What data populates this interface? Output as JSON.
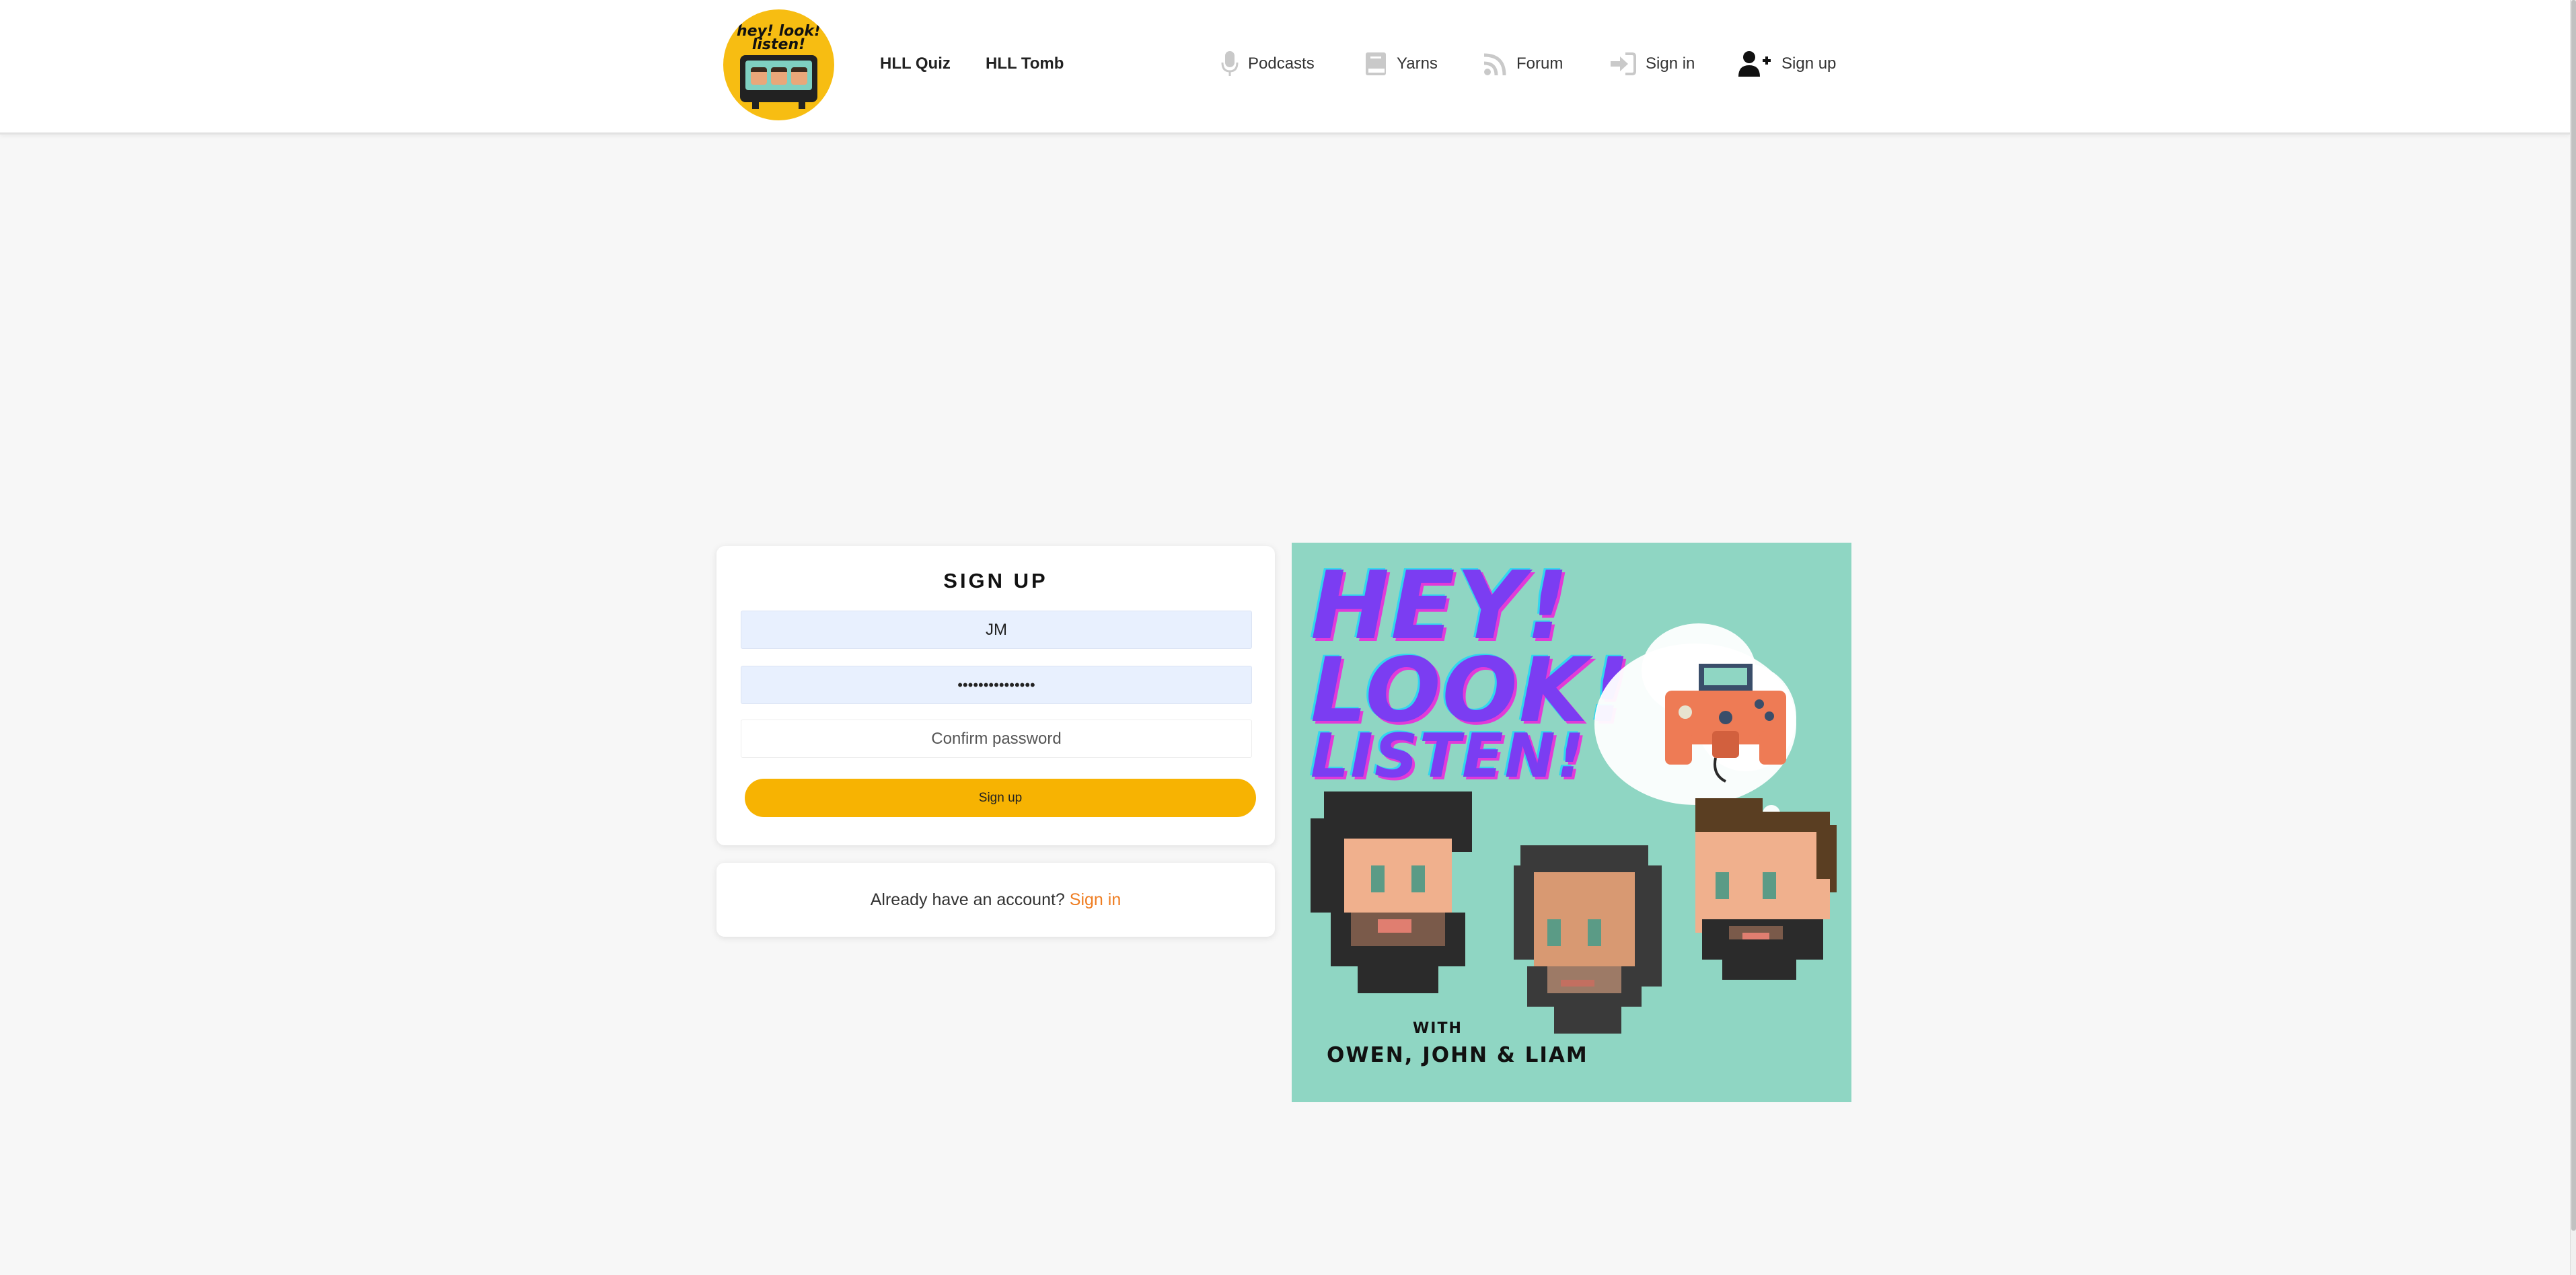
{
  "header": {
    "logo_text_line1": "hey! look!",
    "logo_text_line2": "listen!",
    "left_links": [
      {
        "label": "HLL Quiz"
      },
      {
        "label": "HLL Tomb"
      }
    ],
    "right_links": [
      {
        "label": "Podcasts",
        "icon": "microphone-icon"
      },
      {
        "label": "Yarns",
        "icon": "book-icon"
      },
      {
        "label": "Forum",
        "icon": "feed-icon"
      },
      {
        "label": "Sign in",
        "icon": "sign-in-icon"
      },
      {
        "label": "Sign up",
        "icon": "user-plus-icon"
      }
    ]
  },
  "signup": {
    "title": "SIGN UP",
    "username_value": "JM",
    "password_value": "•••••••••••••••",
    "confirm_placeholder": "Confirm password",
    "button_label": "Sign up"
  },
  "signin_prompt": {
    "text": "Already have an account?",
    "link": "Sign in"
  },
  "artwork": {
    "title_line1": "HEY!",
    "title_line2": "LOOK!",
    "title_line3": "LISTEN!",
    "with": "WITH",
    "names": "OWEN, JOHN & LIAM"
  },
  "colors": {
    "accent": "#f7b302",
    "logo_bg": "#f7bd12",
    "link_orange": "#ef7d22",
    "art_bg": "#8fd6c3"
  }
}
